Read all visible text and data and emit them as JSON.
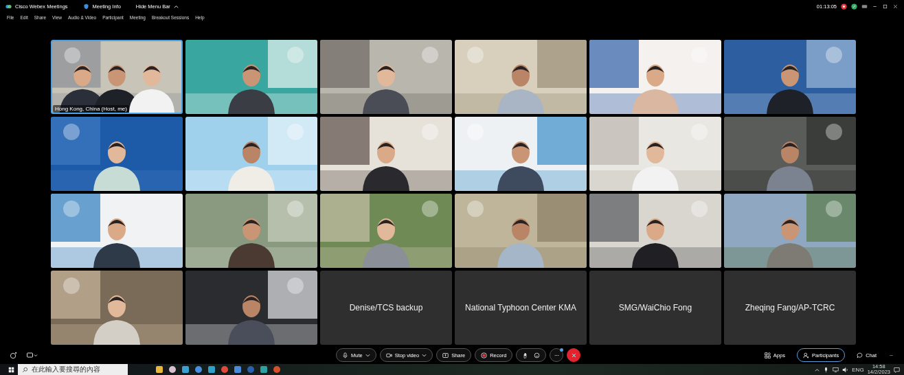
{
  "app": {
    "title": "Cisco Webex Meetings",
    "meeting_info": "Meeting Info",
    "hide_menu": "Hide Menu Bar",
    "timer": "01:13:05"
  },
  "menu": [
    "File",
    "Edit",
    "Share",
    "View",
    "Audio & Video",
    "Participant",
    "Meeting",
    "Breakout Sessions",
    "Help"
  ],
  "tiles": [
    {
      "kind": "video",
      "label": "Hong Kong, China (Host, me)",
      "speaking": true
    },
    {
      "kind": "video",
      "speaking": false
    },
    {
      "kind": "video",
      "speaking": false
    },
    {
      "kind": "video",
      "speaking": false
    },
    {
      "kind": "video",
      "speaking": false
    },
    {
      "kind": "video",
      "speaking": false
    },
    {
      "kind": "video",
      "speaking": false
    },
    {
      "kind": "video",
      "speaking": false
    },
    {
      "kind": "video",
      "speaking": false
    },
    {
      "kind": "video",
      "speaking": false
    },
    {
      "kind": "video",
      "speaking": false
    },
    {
      "kind": "video",
      "speaking": false
    },
    {
      "kind": "video",
      "speaking": false
    },
    {
      "kind": "video",
      "speaking": false
    },
    {
      "kind": "video",
      "speaking": false
    },
    {
      "kind": "video",
      "speaking": false
    },
    {
      "kind": "video",
      "speaking": false
    },
    {
      "kind": "video",
      "speaking": false
    },
    {
      "kind": "video",
      "speaking": false
    },
    {
      "kind": "video",
      "speaking": false
    },
    {
      "kind": "name",
      "name": "Denise/TCS backup",
      "speaking": false
    },
    {
      "kind": "name",
      "name": "National Typhoon Center KMA",
      "speaking": false
    },
    {
      "kind": "name",
      "name": "SMG/WaiChio Fong",
      "speaking": false
    },
    {
      "kind": "name",
      "name": "Zheqing Fang/AP-TCRC",
      "speaking": false
    }
  ],
  "controls": [
    {
      "kind": "mute",
      "label": "Mute",
      "menu": true
    },
    {
      "kind": "video",
      "label": "Stop video",
      "menu": true
    },
    {
      "kind": "share",
      "label": "Share",
      "menu": false
    },
    {
      "kind": "record",
      "label": "Record",
      "menu": false
    },
    {
      "kind": "reactions",
      "menu": false
    },
    {
      "kind": "more",
      "menu": false,
      "notification": true
    },
    {
      "kind": "leave",
      "menu": false
    }
  ],
  "side": [
    {
      "kind": "apps",
      "label": "Apps",
      "selected": false
    },
    {
      "kind": "participants",
      "label": "Participants",
      "selected": true
    },
    {
      "kind": "chat",
      "label": "Chat",
      "selected": false
    }
  ],
  "taskbar": {
    "search_placeholder": "在此輸入要搜尋的內容",
    "language": "ENG",
    "time": "14:58",
    "date": "14/2/2023"
  }
}
